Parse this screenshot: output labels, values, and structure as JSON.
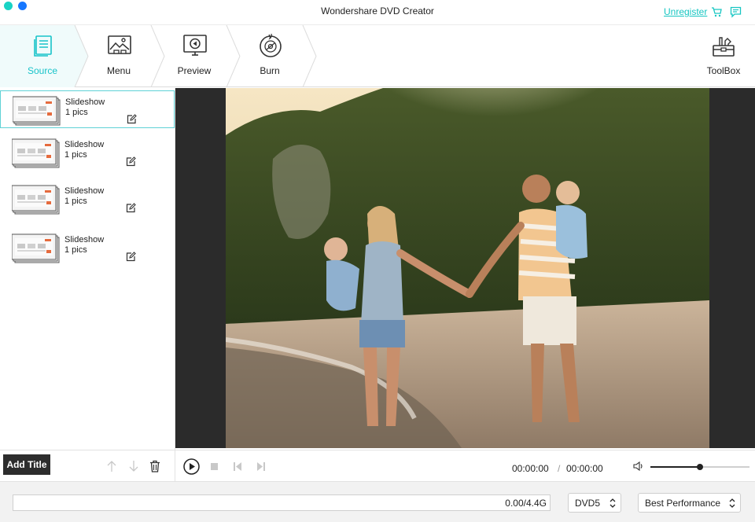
{
  "window": {
    "title": "Wondershare DVD Creator",
    "unregister_label": "Unregister"
  },
  "toolbar": {
    "tabs": [
      {
        "label": "Source",
        "icon": "source-icon",
        "active": true
      },
      {
        "label": "Menu",
        "icon": "menu-template-icon",
        "active": false
      },
      {
        "label": "Preview",
        "icon": "preview-icon",
        "active": false
      },
      {
        "label": "Burn",
        "icon": "burn-disc-icon",
        "active": false
      }
    ],
    "toolbox_label": "ToolBox"
  },
  "slideshows": [
    {
      "title": "Slideshow",
      "count": "1 pics",
      "selected": true
    },
    {
      "title": "Slideshow",
      "count": "1 pics",
      "selected": false
    },
    {
      "title": "Slideshow",
      "count": "1 pics",
      "selected": false
    },
    {
      "title": "Slideshow",
      "count": "1 pics",
      "selected": false
    }
  ],
  "left_bottom": {
    "add_title_label": "Add Title"
  },
  "player": {
    "current_time": "00:00:00",
    "separator": "/",
    "total_time": "00:00:00",
    "volume": 0.5
  },
  "status": {
    "capacity": "0.00/4.4G",
    "disc_type": "DVD5",
    "quality": "Best Performance"
  },
  "colors": {
    "accent": "#18c3c9",
    "dark_button": "#2d2d2d"
  }
}
